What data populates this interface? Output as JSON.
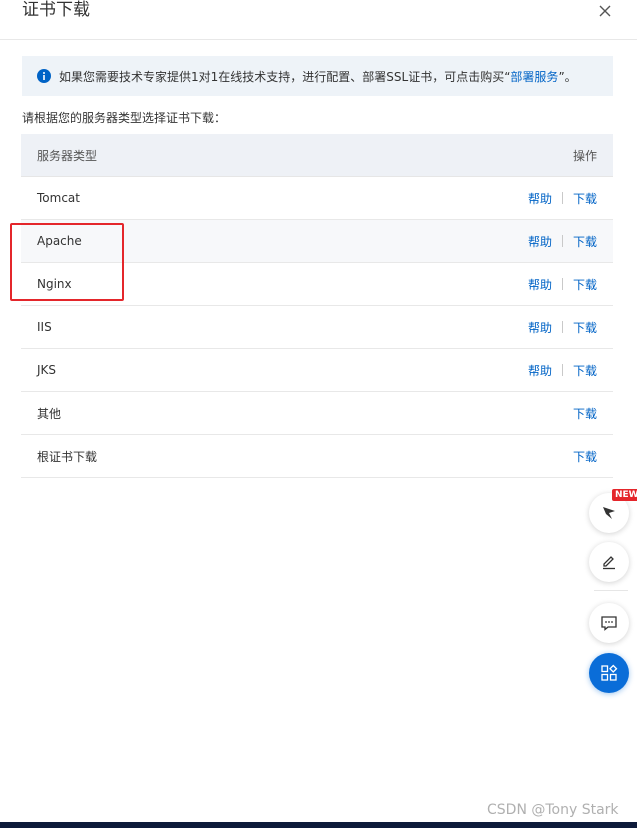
{
  "dialog": {
    "title": "证书下载",
    "close_icon": "close-icon"
  },
  "notice": {
    "icon": "info-circle-icon",
    "text": "如果您需要技术专家提供1对1在线技术支持，进行配置、部署SSL证书，可点击购买“",
    "link_text": "部署服务",
    "suffix": "”。"
  },
  "prompt": "请根据您的服务器类型选择证书下载：",
  "table": {
    "headers": {
      "server_type": "服务器类型",
      "operations": "操作"
    },
    "help_label": "帮助",
    "download_label": "下载",
    "rows": [
      {
        "name": "Tomcat",
        "help": "帮助",
        "download": "下载"
      },
      {
        "name": "Apache",
        "help": "帮助",
        "download": "下载"
      },
      {
        "name": "Nginx",
        "help": "帮助",
        "download": "下载"
      },
      {
        "name": "IIS",
        "help": "帮助",
        "download": "下载"
      },
      {
        "name": "JKS",
        "help": "帮助",
        "download": "下载"
      },
      {
        "name": "其他",
        "download": "下载"
      },
      {
        "name": "根证书下载",
        "download": "下载"
      }
    ]
  },
  "floating_toolbar": {
    "new_badge": "NEW",
    "buttons": [
      "feather-icon",
      "edit-icon",
      "chat-icon",
      "apps-icon"
    ]
  },
  "watermark": "CSDN @Tony Stark",
  "colors": {
    "link": "#0063c6",
    "highlight": "#e4262b",
    "fab_blue": "#0a6dd8",
    "notice_bg": "#eef3f8"
  }
}
